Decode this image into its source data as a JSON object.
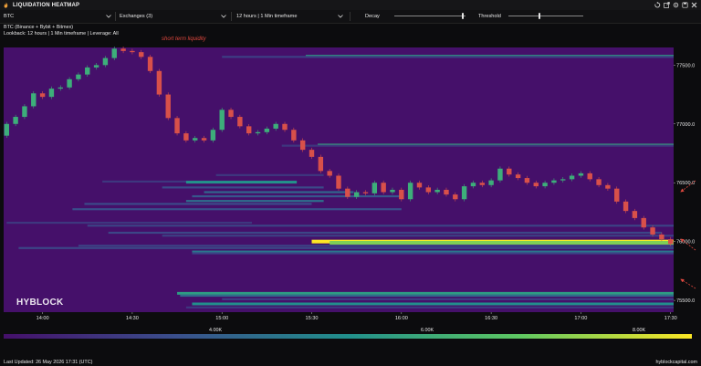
{
  "app": {
    "title": "LIQUIDATION HEATMAP"
  },
  "window_buttons": [
    "restore-icon",
    "popout-icon",
    "settings-icon",
    "save-icon",
    "close-icon"
  ],
  "toolbar": {
    "symbol": "BTC",
    "exchanges": "Exchanges  (3)",
    "timeframe": "12 hours | 1 Min timeframe",
    "decay_label": "Decay",
    "decay_value": 0.95,
    "threshold_label": "Threshold",
    "threshold_value": 0.4
  },
  "info": {
    "line1": "BTC (Binance + Bybit + Bitmex)",
    "line2": "Lookback: 12 hours | 1 Min timeframe | Leverage: All"
  },
  "annotation": {
    "text": "short term liquidity",
    "color": "#e0483e"
  },
  "watermark": "HYBLOCK",
  "footer": {
    "updated": "Last Updated: 26 May 2026 17:31 (UTC)",
    "site": "hyblockcapital.com"
  },
  "colors": {
    "background": "#45106a",
    "price_up": "#3dae7a",
    "price_down": "#d8504a",
    "annotation": "#e0483e"
  },
  "chart_data": {
    "type": "heatmap",
    "title": "",
    "x_tick_labels": [
      "14:00",
      "14:30",
      "15:00",
      "15:30",
      "16:00",
      "16:30",
      "17:00",
      "17:30"
    ],
    "y_tick_labels": [
      "77500.0",
      "77000.0",
      "76500.0",
      "76000.0",
      "75500.0"
    ],
    "ylim": [
      75400,
      77650
    ],
    "time_start": "13:47",
    "time_end": "17:31",
    "colorbar": {
      "ticks": [
        "4.00K",
        "6.00K",
        "8.00K"
      ],
      "range": [
        2000,
        8500
      ],
      "colors": [
        "#45106a",
        "#3a4f8c",
        "#21908c",
        "#5ec962",
        "#fde725"
      ]
    },
    "price_series": [
      {
        "t": "13:48",
        "o": 76900,
        "c": 77000
      },
      {
        "t": "13:51",
        "o": 77000,
        "c": 77060
      },
      {
        "t": "13:54",
        "o": 77060,
        "c": 77150
      },
      {
        "t": "13:57",
        "o": 77150,
        "c": 77260
      },
      {
        "t": "14:00",
        "o": 77260,
        "c": 77230
      },
      {
        "t": "14:03",
        "o": 77230,
        "c": 77300
      },
      {
        "t": "14:06",
        "o": 77300,
        "c": 77310
      },
      {
        "t": "14:09",
        "o": 77310,
        "c": 77380
      },
      {
        "t": "14:12",
        "o": 77380,
        "c": 77420
      },
      {
        "t": "14:15",
        "o": 77420,
        "c": 77480
      },
      {
        "t": "14:18",
        "o": 77480,
        "c": 77500
      },
      {
        "t": "14:21",
        "o": 77500,
        "c": 77560
      },
      {
        "t": "14:24",
        "o": 77560,
        "c": 77640
      },
      {
        "t": "14:27",
        "o": 77640,
        "c": 77620
      },
      {
        "t": "14:30",
        "o": 77620,
        "c": 77610
      },
      {
        "t": "14:33",
        "o": 77610,
        "c": 77570
      },
      {
        "t": "14:36",
        "o": 77570,
        "c": 77450
      },
      {
        "t": "14:39",
        "o": 77450,
        "c": 77250
      },
      {
        "t": "14:42",
        "o": 77250,
        "c": 77050
      },
      {
        "t": "14:45",
        "o": 77050,
        "c": 76920
      },
      {
        "t": "14:48",
        "o": 76920,
        "c": 76860
      },
      {
        "t": "14:51",
        "o": 76860,
        "c": 76880
      },
      {
        "t": "14:54",
        "o": 76880,
        "c": 76860
      },
      {
        "t": "14:57",
        "o": 76860,
        "c": 76950
      },
      {
        "t": "15:00",
        "o": 76950,
        "c": 77120
      },
      {
        "t": "15:03",
        "o": 77120,
        "c": 77060
      },
      {
        "t": "15:06",
        "o": 77060,
        "c": 76980
      },
      {
        "t": "15:09",
        "o": 76980,
        "c": 76920
      },
      {
        "t": "15:12",
        "o": 76920,
        "c": 76930
      },
      {
        "t": "15:15",
        "o": 76930,
        "c": 76960
      },
      {
        "t": "15:18",
        "o": 76960,
        "c": 77000
      },
      {
        "t": "15:21",
        "o": 77000,
        "c": 76950
      },
      {
        "t": "15:24",
        "o": 76950,
        "c": 76860
      },
      {
        "t": "15:27",
        "o": 76860,
        "c": 76780
      },
      {
        "t": "15:30",
        "o": 76780,
        "c": 76720
      },
      {
        "t": "15:33",
        "o": 76720,
        "c": 76600
      },
      {
        "t": "15:36",
        "o": 76600,
        "c": 76560
      },
      {
        "t": "15:39",
        "o": 76560,
        "c": 76450
      },
      {
        "t": "15:42",
        "o": 76450,
        "c": 76380
      },
      {
        "t": "15:45",
        "o": 76380,
        "c": 76420
      },
      {
        "t": "15:48",
        "o": 76420,
        "c": 76410
      },
      {
        "t": "15:51",
        "o": 76410,
        "c": 76500
      },
      {
        "t": "15:54",
        "o": 76500,
        "c": 76420
      },
      {
        "t": "15:57",
        "o": 76420,
        "c": 76440
      },
      {
        "t": "16:00",
        "o": 76440,
        "c": 76360
      },
      {
        "t": "16:03",
        "o": 76360,
        "c": 76500
      },
      {
        "t": "16:06",
        "o": 76500,
        "c": 76460
      },
      {
        "t": "16:09",
        "o": 76460,
        "c": 76420
      },
      {
        "t": "16:12",
        "o": 76420,
        "c": 76440
      },
      {
        "t": "16:15",
        "o": 76440,
        "c": 76400
      },
      {
        "t": "16:18",
        "o": 76400,
        "c": 76360
      },
      {
        "t": "16:21",
        "o": 76360,
        "c": 76470
      },
      {
        "t": "16:24",
        "o": 76470,
        "c": 76500
      },
      {
        "t": "16:27",
        "o": 76500,
        "c": 76480
      },
      {
        "t": "16:30",
        "o": 76480,
        "c": 76520
      },
      {
        "t": "16:33",
        "o": 76520,
        "c": 76620
      },
      {
        "t": "16:36",
        "o": 76620,
        "c": 76570
      },
      {
        "t": "16:39",
        "o": 76570,
        "c": 76540
      },
      {
        "t": "16:42",
        "o": 76540,
        "c": 76500
      },
      {
        "t": "16:45",
        "o": 76500,
        "c": 76470
      },
      {
        "t": "16:48",
        "o": 76470,
        "c": 76500
      },
      {
        "t": "16:51",
        "o": 76500,
        "c": 76520
      },
      {
        "t": "16:54",
        "o": 76520,
        "c": 76530
      },
      {
        "t": "16:57",
        "o": 76530,
        "c": 76560
      },
      {
        "t": "17:00",
        "o": 76560,
        "c": 76580
      },
      {
        "t": "17:03",
        "o": 76580,
        "c": 76530
      },
      {
        "t": "17:06",
        "o": 76530,
        "c": 76480
      },
      {
        "t": "17:09",
        "o": 76480,
        "c": 76450
      },
      {
        "t": "17:12",
        "o": 76450,
        "c": 76340
      },
      {
        "t": "17:15",
        "o": 76340,
        "c": 76260
      },
      {
        "t": "17:18",
        "o": 76260,
        "c": 76200
      },
      {
        "t": "17:21",
        "o": 76200,
        "c": 76120
      },
      {
        "t": "17:24",
        "o": 76120,
        "c": 76060
      },
      {
        "t": "17:27",
        "o": 76060,
        "c": 76020
      },
      {
        "t": "17:30",
        "o": 76020,
        "c": 75980
      }
    ],
    "liquidity_bands": [
      {
        "price": 77575,
        "start": "15:28",
        "end": "17:31",
        "value": 5600
      },
      {
        "price": 77570,
        "start": "15:00",
        "end": "17:31",
        "value": 3200
      },
      {
        "price": 76820,
        "start": "15:32",
        "end": "17:31",
        "value": 5800
      },
      {
        "price": 76815,
        "start": "15:20",
        "end": "17:31",
        "value": 3000
      },
      {
        "price": 76565,
        "start": "14:58",
        "end": "15:34",
        "value": 3000
      },
      {
        "price": 76510,
        "start": "14:20",
        "end": "15:25",
        "value": 3000
      },
      {
        "price": 76505,
        "start": "14:48",
        "end": "15:25",
        "value": 5300
      },
      {
        "price": 76460,
        "start": "14:40",
        "end": "15:34",
        "value": 3500
      },
      {
        "price": 76420,
        "start": "14:54",
        "end": "15:44",
        "value": 4200
      },
      {
        "price": 76385,
        "start": "14:50",
        "end": "16:00",
        "value": 3800
      },
      {
        "price": 76345,
        "start": "14:48",
        "end": "15:34",
        "value": 4400
      },
      {
        "price": 76320,
        "start": "14:14",
        "end": "15:30",
        "value": 3500
      },
      {
        "price": 76275,
        "start": "14:10",
        "end": "16:00",
        "value": 3600
      },
      {
        "price": 76160,
        "start": "13:48",
        "end": "15:10",
        "value": 3000
      },
      {
        "price": 76135,
        "start": "14:15",
        "end": "17:31",
        "value": 3300
      },
      {
        "price": 76075,
        "start": "14:22",
        "end": "17:27",
        "value": 3400
      },
      {
        "price": 76050,
        "start": "14:40",
        "end": "17:31",
        "value": 3200
      },
      {
        "price": 76000,
        "start": "15:30",
        "end": "17:31",
        "value": 8500
      },
      {
        "price": 75990,
        "start": "15:36",
        "end": "17:31",
        "value": 7200
      },
      {
        "price": 75965,
        "start": "14:12",
        "end": "17:31",
        "value": 3200
      },
      {
        "price": 75945,
        "start": "13:52",
        "end": "17:31",
        "value": 3400
      },
      {
        "price": 75915,
        "start": "14:50",
        "end": "17:31",
        "value": 4600
      },
      {
        "price": 75900,
        "start": "14:50",
        "end": "17:31",
        "value": 3300
      },
      {
        "price": 75560,
        "start": "14:45",
        "end": "17:31",
        "value": 5600
      },
      {
        "price": 75540,
        "start": "14:46",
        "end": "17:31",
        "value": 4300
      },
      {
        "price": 75510,
        "start": "15:00",
        "end": "17:31",
        "value": 3200
      },
      {
        "price": 75470,
        "start": "14:50",
        "end": "17:31",
        "value": 5200
      },
      {
        "price": 75440,
        "start": "14:48",
        "end": "17:31",
        "value": 3000
      }
    ]
  }
}
